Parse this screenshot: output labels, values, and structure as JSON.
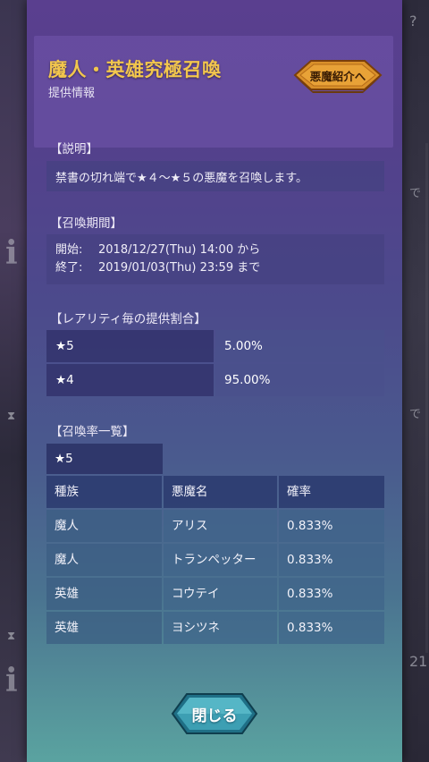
{
  "dialog": {
    "title": "魔人・英雄究極召喚",
    "subtitle": "提供情報",
    "demon_intro_button": "悪魔紹介へ",
    "close_button": "閉じる"
  },
  "description": {
    "label": "【説明】",
    "text": "禁書の切れ端で★４〜★５の悪魔を召喚します。"
  },
  "period": {
    "label": "【召喚期間】",
    "start_key": "開始:",
    "start_value": "2018/12/27(Thu) 14:00 から",
    "end_key": "終了:",
    "end_value": "2019/01/03(Thu) 23:59 まで"
  },
  "rarity_rates": {
    "label": "【レアリティ毎の提供割合】",
    "rows": [
      {
        "rarity": "★5",
        "rate": "5.00%"
      },
      {
        "rarity": "★4",
        "rate": "95.00%"
      }
    ]
  },
  "summon_list": {
    "label": "【召喚率一覧】",
    "tab": "★5",
    "headers": [
      "種族",
      "悪魔名",
      "確率"
    ],
    "rows": [
      [
        "魔人",
        "アリス",
        "0.833%"
      ],
      [
        "魔人",
        "トランペッター",
        "0.833%"
      ],
      [
        "英雄",
        "コウテイ",
        "0.833%"
      ],
      [
        "英雄",
        "ヨシツネ",
        "0.833%"
      ]
    ]
  },
  "background": {
    "glyph_i": "i",
    "glyph_hourglass": "⧗",
    "glyph_question": "?",
    "right_text_de": "で",
    "right_number": "21"
  },
  "colors": {
    "title": "#f2c64d",
    "button_gold": "#d9902a",
    "close_button": "#3d9fb3"
  }
}
